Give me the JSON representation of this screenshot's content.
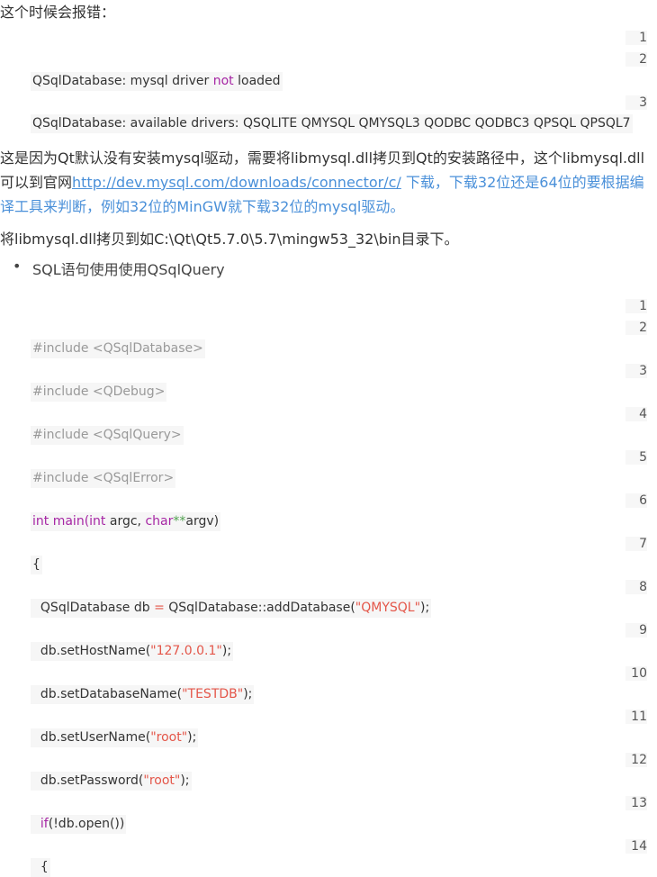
{
  "intro": "这个时候会报错：",
  "block1": {
    "line_numbers": [
      "1",
      "2",
      "3"
    ],
    "lines": [
      {
        "a": "QSqlDatabase: mysql driver ",
        "kw": "not",
        "b": " loaded"
      },
      {
        "text": "QSqlDatabase: available drivers: QSQLITE QMYSQL QMYSQL3 QODBC QODBC3 QPSQL QPSQL7"
      }
    ]
  },
  "para1": {
    "line1": "这是因为Qt默认没有安装mysql驱动，需要将libmysql.dll拷贝到Qt的安装路径中，这个libmysql.dll",
    "line2_a": "可以到官网",
    "line2_link": "http://dev.mysql.com/downloads/connector/c/",
    "line2_b": " 下载，下载32位还是64位的要根据编",
    "line3": "译工具来判断，例如32位的MinGW就下载32位的mysql驱动。"
  },
  "para2": "将libmysql.dll拷贝到如C:\\Qt\\Qt5.7.0\\5.7\\mingw53_32\\bin目录下。",
  "bullet": {
    "symbol": "•",
    "text": "SQL语句使用使用QSqlQuery"
  },
  "block2": {
    "line_numbers": [
      "1",
      "2",
      "3",
      "4",
      "5",
      "6",
      "7",
      "8",
      "9",
      "10",
      "11",
      "12",
      "13",
      "14"
    ],
    "inc1": "#include <QSqlDatabase>",
    "inc2": "#include <QDebug>",
    "inc3": "#include <QSqlQuery>",
    "inc4": "#include <QSqlError>",
    "main_kw1": "int",
    "main_fn": " main(",
    "main_kw2": "int",
    "main_argc": " argc, ",
    "main_kw3": "char",
    "main_op": "**",
    "main_argv": "argv)",
    "brace_open": "{",
    "db_a": "QSqlDatabase db ",
    "db_eq": "=",
    "db_b": " QSqlDatabase::addDatabase(",
    "db_str": "\"QMYSQL\"",
    "db_c": ");",
    "host_a": "db.setHostName(",
    "host_str": "\"127.0.0.1\"",
    "host_b": ");",
    "dbn_a": "db.setDatabaseName(",
    "dbn_str": "\"TESTDB\"",
    "dbn_b": ");",
    "user_a": "db.setUserName(",
    "user_str": "\"root\"",
    "user_b": ");",
    "pw_a": "db.setPassword(",
    "pw_str": "\"root\"",
    "pw_b": ");",
    "if_kw": "if",
    "if_rest": "(!db.open())",
    "brace2": "{"
  }
}
